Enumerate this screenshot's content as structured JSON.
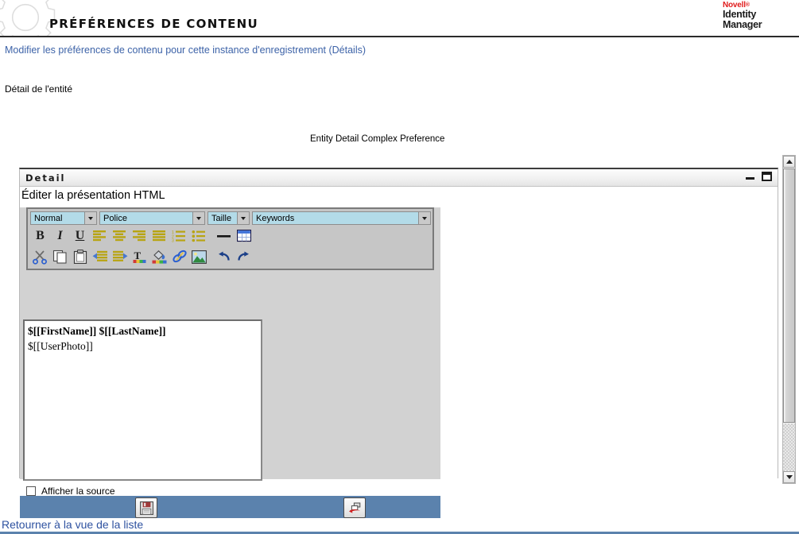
{
  "header": {
    "title": "PRÉFÉRENCES DE CONTENU",
    "gear_icon": "gear-icon",
    "brand": {
      "novell": "Novell",
      "registered": "®",
      "line1": "Identity",
      "line2": "Manager"
    }
  },
  "subtitle": {
    "link_text": "Modifier les préférences de contenu pour cette instance d'enregistrement (Détails)"
  },
  "body": {
    "entity_detail_label": "Détail de l'entité",
    "complex_preference_label": "Entity Detail Complex Preference"
  },
  "panel": {
    "title": "Detail",
    "minimize_icon": "minimize-icon",
    "maximize_icon": "maximize-icon",
    "editor_heading": "Éditer la présentation HTML"
  },
  "toolbar": {
    "selects": [
      {
        "name": "paragraph-style-select",
        "value": "Normal"
      },
      {
        "name": "font-family-select",
        "value": "Police"
      },
      {
        "name": "font-size-select",
        "value": "Taille"
      },
      {
        "name": "keywords-select",
        "value": "Keywords"
      }
    ],
    "row1": [
      {
        "name": "bold-button",
        "icon": "bold-icon",
        "label": "B"
      },
      {
        "name": "italic-button",
        "icon": "italic-icon",
        "label": "I"
      },
      {
        "name": "underline-button",
        "icon": "underline-icon",
        "label": "U"
      },
      {
        "name": "align-left-button",
        "icon": "align-left-icon"
      },
      {
        "name": "align-center-button",
        "icon": "align-center-icon"
      },
      {
        "name": "align-right-button",
        "icon": "align-right-icon"
      },
      {
        "name": "align-justify-button",
        "icon": "align-justify-icon"
      },
      {
        "name": "ordered-list-button",
        "icon": "numbered-list-icon"
      },
      {
        "name": "unordered-list-button",
        "icon": "bulleted-list-icon"
      },
      {
        "name": "horizontal-rule-button",
        "icon": "horizontal-rule-icon"
      },
      {
        "name": "insert-table-button",
        "icon": "table-icon"
      }
    ],
    "row2": [
      {
        "name": "cut-button",
        "icon": "scissors-icon"
      },
      {
        "name": "copy-button",
        "icon": "copy-icon"
      },
      {
        "name": "paste-button",
        "icon": "clipboard-icon"
      },
      {
        "name": "outdent-button",
        "icon": "outdent-icon"
      },
      {
        "name": "indent-button",
        "icon": "indent-icon"
      },
      {
        "name": "text-color-button",
        "icon": "text-color-icon"
      },
      {
        "name": "background-color-button",
        "icon": "fill-color-icon"
      },
      {
        "name": "insert-link-button",
        "icon": "link-icon"
      },
      {
        "name": "insert-image-button",
        "icon": "image-icon"
      },
      {
        "name": "undo-button",
        "icon": "undo-icon"
      },
      {
        "name": "redo-button",
        "icon": "redo-icon"
      }
    ]
  },
  "editor": {
    "line1": "$[[FirstName]] $[[LastName]]",
    "line2": "$[[UserPhoto]]"
  },
  "source_checkbox": {
    "label": "Afficher la source",
    "checked": false
  },
  "footer_buttons": [
    {
      "name": "save-button",
      "icon": "floppy-disk-icon"
    },
    {
      "name": "cancel-button",
      "icon": "revert-icon"
    }
  ],
  "scrollbar": {
    "up_icon": "scroll-up-arrow-icon",
    "down_icon": "scroll-down-arrow-icon"
  },
  "bottom": {
    "link_text": "Retourner à la vue de la liste"
  },
  "colors": {
    "brand_red": "#e01b1b",
    "link_blue": "#3d63a8",
    "footer_blue": "#5b82ad",
    "dropdown_blue": "#b3dbe8",
    "toolbar_gray": "#c6c6c6",
    "panel_gray": "#d2d2d2"
  }
}
